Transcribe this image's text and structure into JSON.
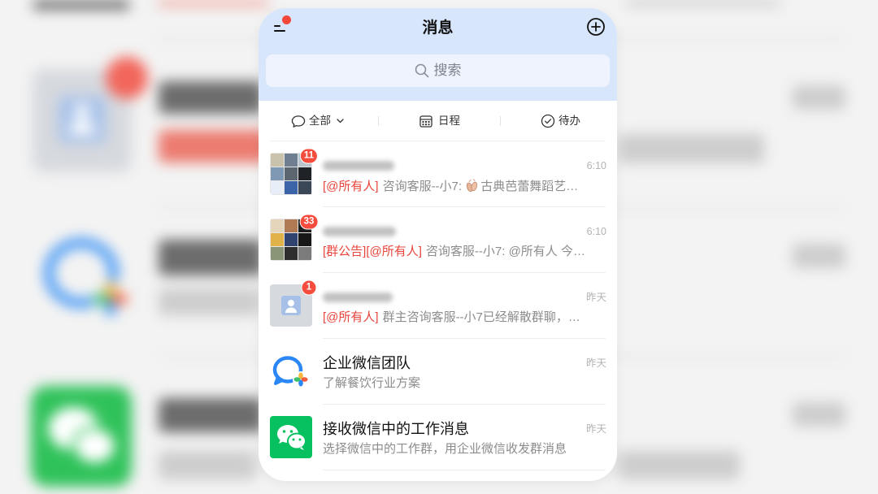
{
  "header": {
    "title": "消息",
    "search_placeholder": "搜索",
    "icons": {
      "menu": "menu-icon",
      "add": "plus-circle-icon",
      "search": "search-icon"
    }
  },
  "filters": {
    "all": "全部",
    "schedule": "日程",
    "todo": "待办",
    "icons": {
      "all": "chat-bubble-icon",
      "schedule": "calendar-icon",
      "todo": "check-circle-icon",
      "dropdown": "chevron-down-icon"
    }
  },
  "conversations": [
    {
      "avatar": "group-avatar-icon",
      "badge": "11",
      "time": "6:10",
      "preview": {
        "tag": "[@所有人]",
        "text": "咨询客服--小7: ",
        "icon": "ballet-shoes-icon",
        "text_after": "古典芭蕾舞蹈艺…"
      }
    },
    {
      "avatar": "group-avatar-icon",
      "badge": "33",
      "time": "6:10",
      "preview": {
        "tag": "[群公告][@所有人]",
        "text": "咨询客服--小7: @所有人 今…"
      }
    },
    {
      "avatar": "person-placeholder-icon",
      "badge": "1",
      "time": "昨天",
      "preview": {
        "tag": "[@所有人]",
        "text": "群主咨询客服--小7已经解散群聊，…"
      }
    },
    {
      "avatar": "wecom-logo-icon",
      "name": "企业微信团队",
      "time": "昨天",
      "preview": {
        "text": "了解餐饮行业方案"
      }
    },
    {
      "avatar": "wechat-logo-icon",
      "name": "接收微信中的工作消息",
      "time": "昨天",
      "preview": {
        "text": "选择微信中的工作群，用企业微信收发群消息"
      }
    }
  ],
  "colors": {
    "header_bg": "#d8e6fc",
    "badge": "#f44d3d",
    "mention": "#e8453c",
    "wecom_blue": "#2b87f6",
    "wechat_green": "#07c160",
    "menu_dot": "#f2473b"
  }
}
